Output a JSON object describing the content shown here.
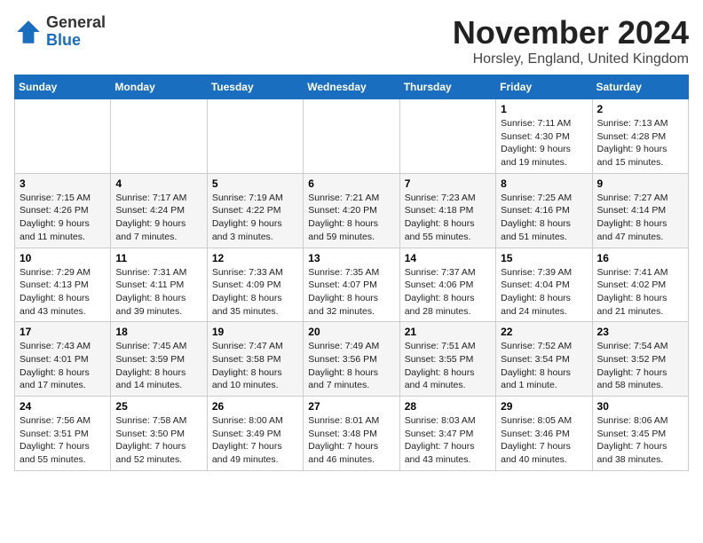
{
  "logo": {
    "general": "General",
    "blue": "Blue"
  },
  "title": "November 2024",
  "location": "Horsley, England, United Kingdom",
  "days_of_week": [
    "Sunday",
    "Monday",
    "Tuesday",
    "Wednesday",
    "Thursday",
    "Friday",
    "Saturday"
  ],
  "weeks": [
    [
      {
        "day": "",
        "info": ""
      },
      {
        "day": "",
        "info": ""
      },
      {
        "day": "",
        "info": ""
      },
      {
        "day": "",
        "info": ""
      },
      {
        "day": "",
        "info": ""
      },
      {
        "day": "1",
        "info": "Sunrise: 7:11 AM\nSunset: 4:30 PM\nDaylight: 9 hours and 19 minutes."
      },
      {
        "day": "2",
        "info": "Sunrise: 7:13 AM\nSunset: 4:28 PM\nDaylight: 9 hours and 15 minutes."
      }
    ],
    [
      {
        "day": "3",
        "info": "Sunrise: 7:15 AM\nSunset: 4:26 PM\nDaylight: 9 hours and 11 minutes."
      },
      {
        "day": "4",
        "info": "Sunrise: 7:17 AM\nSunset: 4:24 PM\nDaylight: 9 hours and 7 minutes."
      },
      {
        "day": "5",
        "info": "Sunrise: 7:19 AM\nSunset: 4:22 PM\nDaylight: 9 hours and 3 minutes."
      },
      {
        "day": "6",
        "info": "Sunrise: 7:21 AM\nSunset: 4:20 PM\nDaylight: 8 hours and 59 minutes."
      },
      {
        "day": "7",
        "info": "Sunrise: 7:23 AM\nSunset: 4:18 PM\nDaylight: 8 hours and 55 minutes."
      },
      {
        "day": "8",
        "info": "Sunrise: 7:25 AM\nSunset: 4:16 PM\nDaylight: 8 hours and 51 minutes."
      },
      {
        "day": "9",
        "info": "Sunrise: 7:27 AM\nSunset: 4:14 PM\nDaylight: 8 hours and 47 minutes."
      }
    ],
    [
      {
        "day": "10",
        "info": "Sunrise: 7:29 AM\nSunset: 4:13 PM\nDaylight: 8 hours and 43 minutes."
      },
      {
        "day": "11",
        "info": "Sunrise: 7:31 AM\nSunset: 4:11 PM\nDaylight: 8 hours and 39 minutes."
      },
      {
        "day": "12",
        "info": "Sunrise: 7:33 AM\nSunset: 4:09 PM\nDaylight: 8 hours and 35 minutes."
      },
      {
        "day": "13",
        "info": "Sunrise: 7:35 AM\nSunset: 4:07 PM\nDaylight: 8 hours and 32 minutes."
      },
      {
        "day": "14",
        "info": "Sunrise: 7:37 AM\nSunset: 4:06 PM\nDaylight: 8 hours and 28 minutes."
      },
      {
        "day": "15",
        "info": "Sunrise: 7:39 AM\nSunset: 4:04 PM\nDaylight: 8 hours and 24 minutes."
      },
      {
        "day": "16",
        "info": "Sunrise: 7:41 AM\nSunset: 4:02 PM\nDaylight: 8 hours and 21 minutes."
      }
    ],
    [
      {
        "day": "17",
        "info": "Sunrise: 7:43 AM\nSunset: 4:01 PM\nDaylight: 8 hours and 17 minutes."
      },
      {
        "day": "18",
        "info": "Sunrise: 7:45 AM\nSunset: 3:59 PM\nDaylight: 8 hours and 14 minutes."
      },
      {
        "day": "19",
        "info": "Sunrise: 7:47 AM\nSunset: 3:58 PM\nDaylight: 8 hours and 10 minutes."
      },
      {
        "day": "20",
        "info": "Sunrise: 7:49 AM\nSunset: 3:56 PM\nDaylight: 8 hours and 7 minutes."
      },
      {
        "day": "21",
        "info": "Sunrise: 7:51 AM\nSunset: 3:55 PM\nDaylight: 8 hours and 4 minutes."
      },
      {
        "day": "22",
        "info": "Sunrise: 7:52 AM\nSunset: 3:54 PM\nDaylight: 8 hours and 1 minute."
      },
      {
        "day": "23",
        "info": "Sunrise: 7:54 AM\nSunset: 3:52 PM\nDaylight: 7 hours and 58 minutes."
      }
    ],
    [
      {
        "day": "24",
        "info": "Sunrise: 7:56 AM\nSunset: 3:51 PM\nDaylight: 7 hours and 55 minutes."
      },
      {
        "day": "25",
        "info": "Sunrise: 7:58 AM\nSunset: 3:50 PM\nDaylight: 7 hours and 52 minutes."
      },
      {
        "day": "26",
        "info": "Sunrise: 8:00 AM\nSunset: 3:49 PM\nDaylight: 7 hours and 49 minutes."
      },
      {
        "day": "27",
        "info": "Sunrise: 8:01 AM\nSunset: 3:48 PM\nDaylight: 7 hours and 46 minutes."
      },
      {
        "day": "28",
        "info": "Sunrise: 8:03 AM\nSunset: 3:47 PM\nDaylight: 7 hours and 43 minutes."
      },
      {
        "day": "29",
        "info": "Sunrise: 8:05 AM\nSunset: 3:46 PM\nDaylight: 7 hours and 40 minutes."
      },
      {
        "day": "30",
        "info": "Sunrise: 8:06 AM\nSunset: 3:45 PM\nDaylight: 7 hours and 38 minutes."
      }
    ]
  ]
}
